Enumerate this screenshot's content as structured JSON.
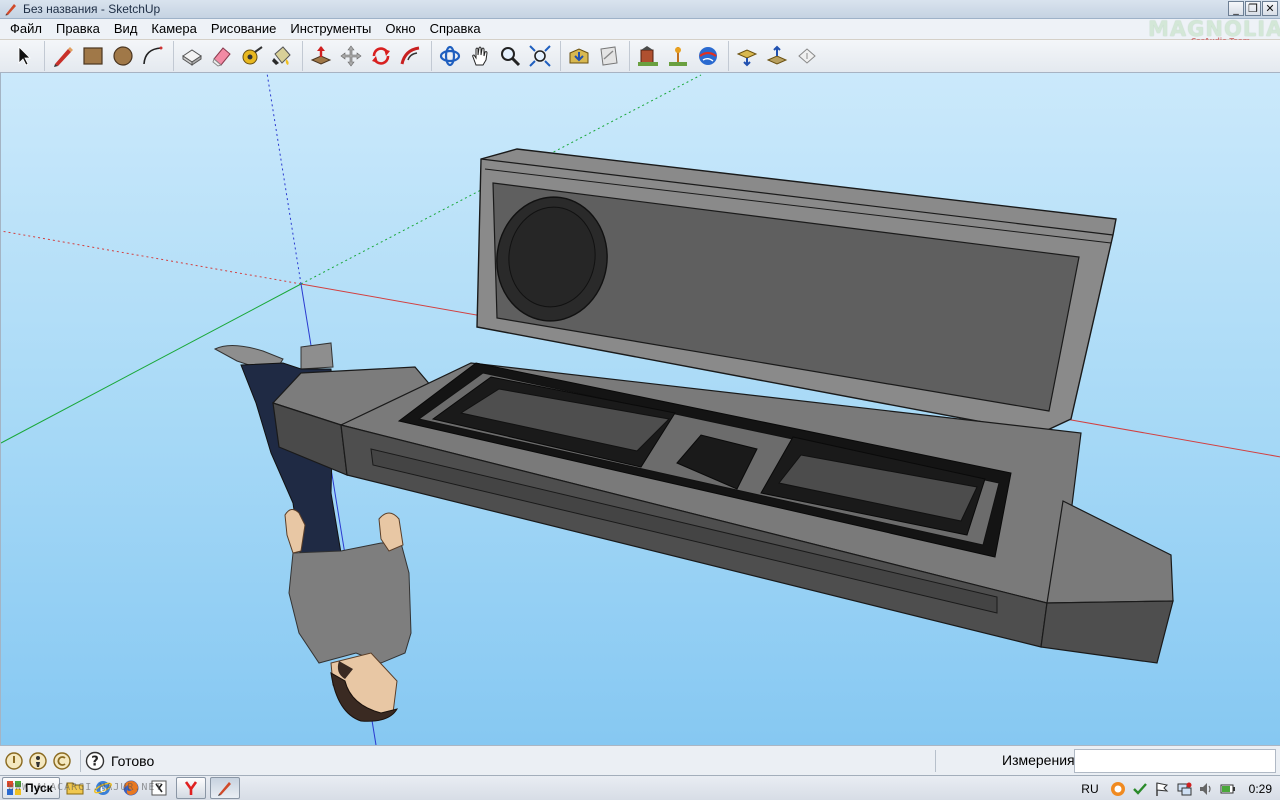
{
  "window": {
    "title": "Без названия - SketchUp",
    "controls": {
      "minimize": "_",
      "maximize": "❐",
      "close": "✕"
    }
  },
  "logo": {
    "main": "MAGNOLIA",
    "sub": "CarAudio Team"
  },
  "menu": [
    "Файл",
    "Правка",
    "Вид",
    "Камера",
    "Рисование",
    "Инструменты",
    "Окно",
    "Справка"
  ],
  "toolbar": {
    "groups": [
      [
        "select-icon"
      ],
      [
        "pencil-icon",
        "rectangle-icon",
        "circle-icon",
        "arc-icon"
      ],
      [
        "make-component-icon",
        "eraser-icon",
        "tape-measure-icon",
        "paint-bucket-icon"
      ],
      [
        "push-pull-icon",
        "move-icon",
        "rotate-icon",
        "follow-me-icon"
      ],
      [
        "orbit-icon",
        "pan-icon",
        "zoom-icon",
        "zoom-extents-icon"
      ],
      [
        "get-models-icon",
        "share-model-icon"
      ],
      [
        "building-icon",
        "place-model-icon",
        "google-earth-icon"
      ],
      [
        "get-current-view-icon",
        "toggle-terrain-icon",
        "preview-icon"
      ]
    ]
  },
  "viewport": {
    "colors": {
      "sky_top": "#cbe9fb",
      "sky_bottom": "#86c8f2",
      "model_dark": "#3a3a3a",
      "model_mid": "#6a6a6a",
      "model_light": "#8a8a8a"
    }
  },
  "status": {
    "icons": [
      "geo-location-icon",
      "credits-icon",
      "user-icon"
    ],
    "help_icon": "help-icon",
    "text": "Готово",
    "measure_label": "Измерения",
    "measure_value": ""
  },
  "taskbar": {
    "start_label": "Пуск",
    "watermark": "WWW.ALACARGI.MAJUR.NET",
    "quick_launch": [
      "folder-icon",
      "ie-icon",
      "firefox-icon",
      "java-icon"
    ],
    "tasks": [
      "yandex-icon",
      "sketchup-icon"
    ],
    "lang": "RU",
    "tray": [
      "avast-icon",
      "check-icon",
      "flag-icon",
      "network-icon",
      "volume-icon",
      "battery-icon"
    ],
    "clock": "0:29"
  }
}
